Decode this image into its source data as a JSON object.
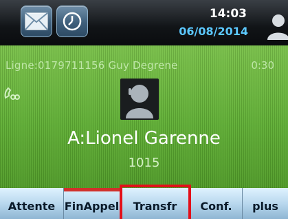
{
  "status_bar": {
    "time": "14:03",
    "date": "06/08/2014",
    "icons": [
      "mail-icon",
      "clock-icon",
      "user-icon"
    ]
  },
  "call": {
    "line_info": "Ligne:0179711156 Guy Degrene",
    "duration": "0:30",
    "callee_name": "A:Lionel Garenne",
    "extension": "1015"
  },
  "softkeys": {
    "hold": "Attente",
    "end_call": "FinAppel",
    "transfer": "Transfr",
    "conference": "Conf.",
    "more": "plus"
  },
  "colors": {
    "screen_green": "#5fae34",
    "date_blue": "#5cc8ff",
    "softkey_bg": "#b9d8ee",
    "highlight_red": "#e3101a"
  }
}
